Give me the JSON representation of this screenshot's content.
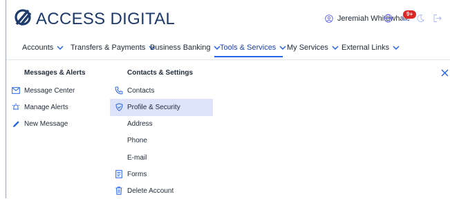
{
  "brand": {
    "name": "ACCESS DIGITAL"
  },
  "user": {
    "name": "Jeremiah Whitewhale"
  },
  "notifications": {
    "badge": "9+"
  },
  "nav": [
    {
      "label": "Accounts"
    },
    {
      "label": "Transfers & Payments"
    },
    {
      "label": "Business Banking"
    },
    {
      "label": "Tools & Services"
    },
    {
      "label": "My Services"
    },
    {
      "label": "External Links"
    }
  ],
  "menu": {
    "col1_title": "Messages & Alerts",
    "col1": [
      {
        "label": "Message Center",
        "icon": "envelope-icon"
      },
      {
        "label": "Manage Alerts",
        "icon": "alarm-icon"
      },
      {
        "label": "New Message",
        "icon": "pencil-icon"
      }
    ],
    "col2_title": "Contacts & Settings",
    "col2": [
      {
        "label": "Contacts",
        "icon": "phone-icon"
      },
      {
        "label": "Profile & Security",
        "icon": "shield-icon"
      },
      {
        "label": "Address"
      },
      {
        "label": "Phone"
      },
      {
        "label": "E-mail"
      },
      {
        "label": "Forms",
        "icon": "document-icon"
      },
      {
        "label": "Delete Account",
        "icon": "trash-icon"
      }
    ]
  },
  "colors": {
    "brand": "#1e3a6b",
    "accent": "#2563eb",
    "highlight": "#dde3fb",
    "badge": "#dc2626"
  }
}
